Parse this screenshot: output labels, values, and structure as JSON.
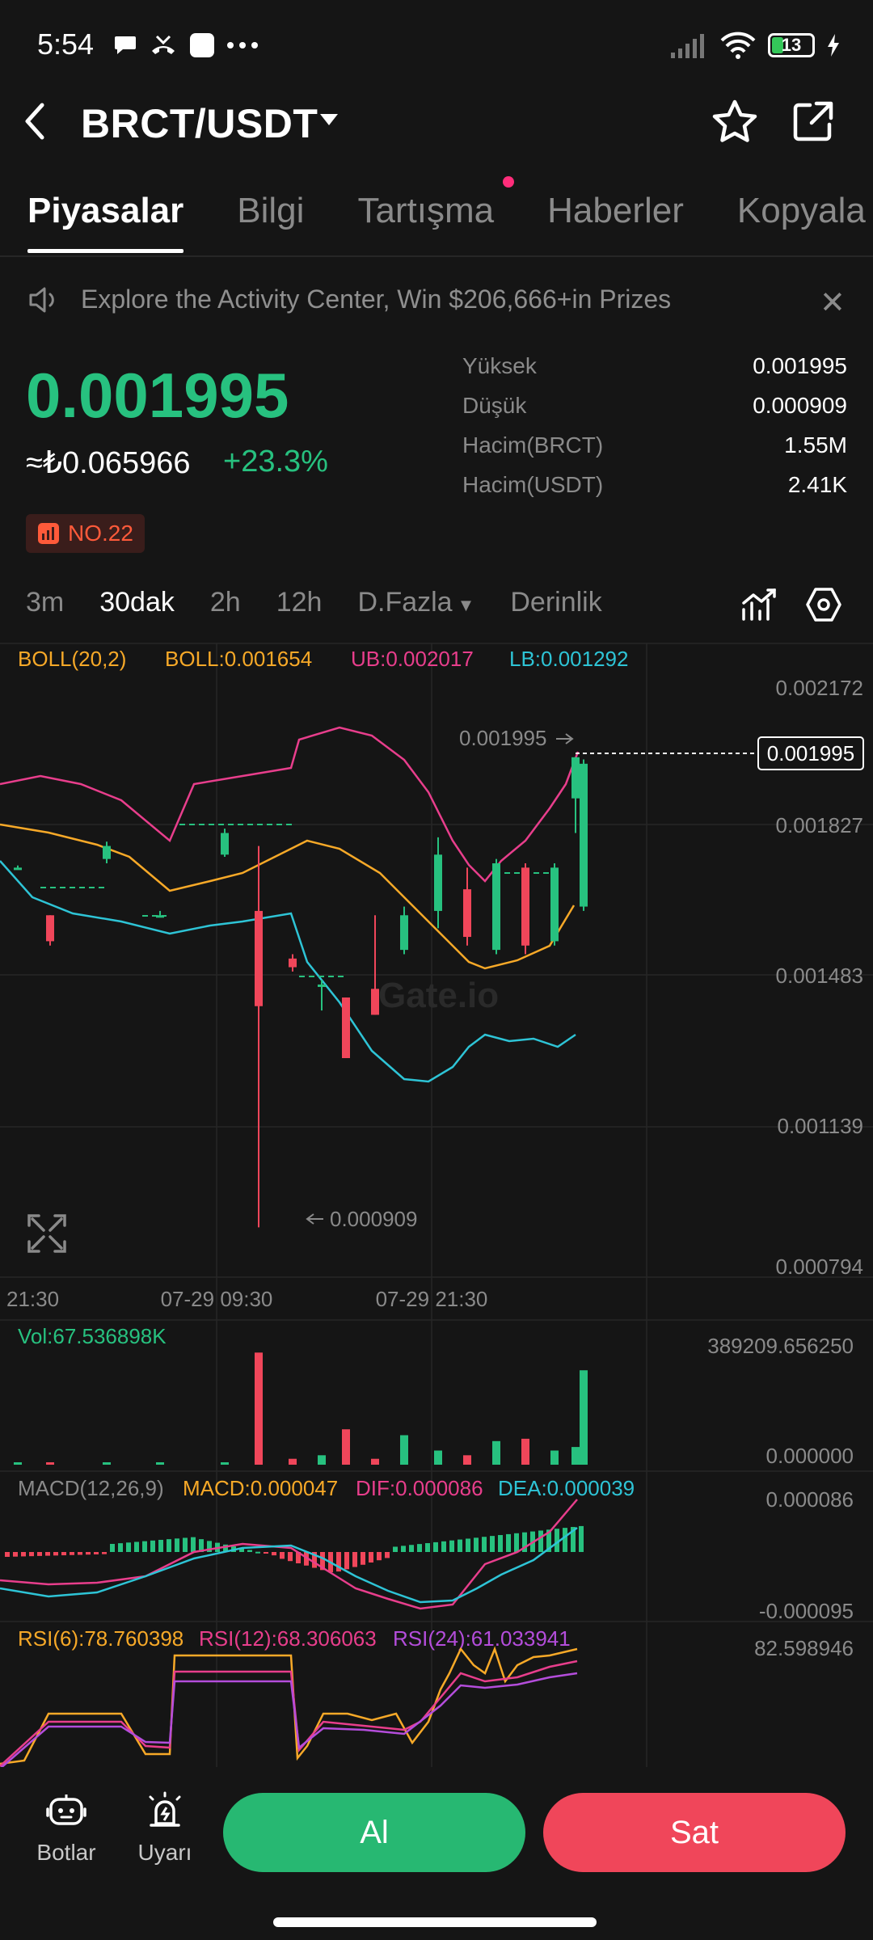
{
  "status_bar": {
    "time": "5:54",
    "battery": "13"
  },
  "header": {
    "pair": "BRCT/USDT"
  },
  "tabs": [
    {
      "label": "Piyasalar",
      "active": true
    },
    {
      "label": "Bilgi"
    },
    {
      "label": "Tartışma"
    },
    {
      "label": "Haberler"
    },
    {
      "label": "Kopyala"
    }
  ],
  "banner": {
    "text": "Explore the Activity Center, Win $206,666+in Prizes"
  },
  "price": {
    "last": "0.001995",
    "fiat": "≈₺0.065966",
    "change": "+23.3%",
    "rank": "NO.22"
  },
  "stats": [
    {
      "label": "Yüksek",
      "value": "0.001995"
    },
    {
      "label": "Düşük",
      "value": "0.000909"
    },
    {
      "label": "Hacim(BRCT)",
      "value": "1.55M"
    },
    {
      "label": "Hacim(USDT)",
      "value": "2.41K"
    }
  ],
  "timeframes": {
    "t1": "3m",
    "t2": "30dak",
    "t3": "2h",
    "t4": "12h",
    "more": "D.Fazla",
    "depth": "Derinlik"
  },
  "indicators": {
    "boll": {
      "name": "BOLL(20,2)",
      "mid": "BOLL:0.001654",
      "ub": "UB:0.002017",
      "lb": "LB:0.001292"
    },
    "vol": {
      "label": "Vol:67.536898K",
      "max": "389209.656250",
      "min": "0.000000"
    },
    "macd": {
      "name": "MACD(12,26,9)",
      "macd": "MACD:0.000047",
      "dif": "DIF:0.000086",
      "dea": "DEA:0.000039",
      "max": "0.000086",
      "min": "-0.000095"
    },
    "rsi": {
      "r6": "RSI(6):78.760398",
      "r12": "RSI(12):68.306063",
      "r24": "RSI(24):61.033941",
      "max": "82.598946"
    }
  },
  "chart": {
    "y_labels": [
      "0.002172",
      "0.001827",
      "0.001483",
      "0.001139",
      "0.000794"
    ],
    "x_labels": [
      "21:30",
      "07-29 09:30",
      "07-29 21:30"
    ],
    "high_marker": "0.001995",
    "low_marker": "0.000909",
    "current_price": "0.001995",
    "watermark": "Gate.io",
    "colors": {
      "up": "#27c17f",
      "down": "#f0465a",
      "ub": "#e83e8c",
      "mid": "#f7a928",
      "lb": "#2ec4d6"
    }
  },
  "chart_data": {
    "type": "candlestick",
    "ylim": [
      0.000794,
      0.002172
    ],
    "candles": [
      {
        "o": 0.00174,
        "c": 0.00174,
        "h": 0.001745,
        "l": 0.001735
      },
      {
        "o": 0.00163,
        "c": 0.00157,
        "h": 0.00163,
        "l": 0.00156
      },
      {
        "o": 0.00176,
        "c": 0.00179,
        "h": 0.0018,
        "l": 0.00175
      },
      {
        "o": 0.00163,
        "c": 0.00163,
        "h": 0.00164,
        "l": 0.001625
      },
      {
        "o": 0.00177,
        "c": 0.00182,
        "h": 0.00183,
        "l": 0.001765
      },
      {
        "o": 0.00164,
        "c": 0.00142,
        "h": 0.00179,
        "l": 0.000909
      },
      {
        "o": 0.00153,
        "c": 0.00151,
        "h": 0.00154,
        "l": 0.0015
      },
      {
        "o": 0.00147,
        "c": 0.00147,
        "h": 0.00148,
        "l": 0.00141
      },
      {
        "o": 0.00144,
        "c": 0.0013,
        "h": 0.00144,
        "l": 0.0013
      },
      {
        "o": 0.00146,
        "c": 0.0014,
        "h": 0.00163,
        "l": 0.0014
      },
      {
        "o": 0.00155,
        "c": 0.00163,
        "h": 0.00165,
        "l": 0.00154
      },
      {
        "o": 0.00164,
        "c": 0.00177,
        "h": 0.00181,
        "l": 0.0016
      },
      {
        "o": 0.00169,
        "c": 0.00158,
        "h": 0.00174,
        "l": 0.00156
      },
      {
        "o": 0.00155,
        "c": 0.00175,
        "h": 0.00176,
        "l": 0.00154
      },
      {
        "o": 0.00174,
        "c": 0.00156,
        "h": 0.00175,
        "l": 0.00154
      },
      {
        "o": 0.00157,
        "c": 0.00174,
        "h": 0.00175,
        "l": 0.00156
      },
      {
        "o": 0.00165,
        "c": 0.00198,
        "h": 0.00199,
        "l": 0.00164
      },
      {
        "o": 0.0019,
        "c": 0.001995,
        "h": 0.001995,
        "l": 0.00182
      }
    ],
    "volume": [
      0.02,
      0.01,
      0.02,
      0.01,
      0.01,
      0.95,
      0.05,
      0.08,
      0.3,
      0.05,
      0.25,
      0.12,
      0.08,
      0.2,
      0.22,
      0.12,
      0.8,
      0.15
    ],
    "rsi_levels": [
      78.760398,
      68.306063,
      61.033941
    ]
  },
  "bottom_bar": {
    "bots": "Botlar",
    "alert": "Uyarı",
    "buy": "Al",
    "sell": "Sat"
  }
}
